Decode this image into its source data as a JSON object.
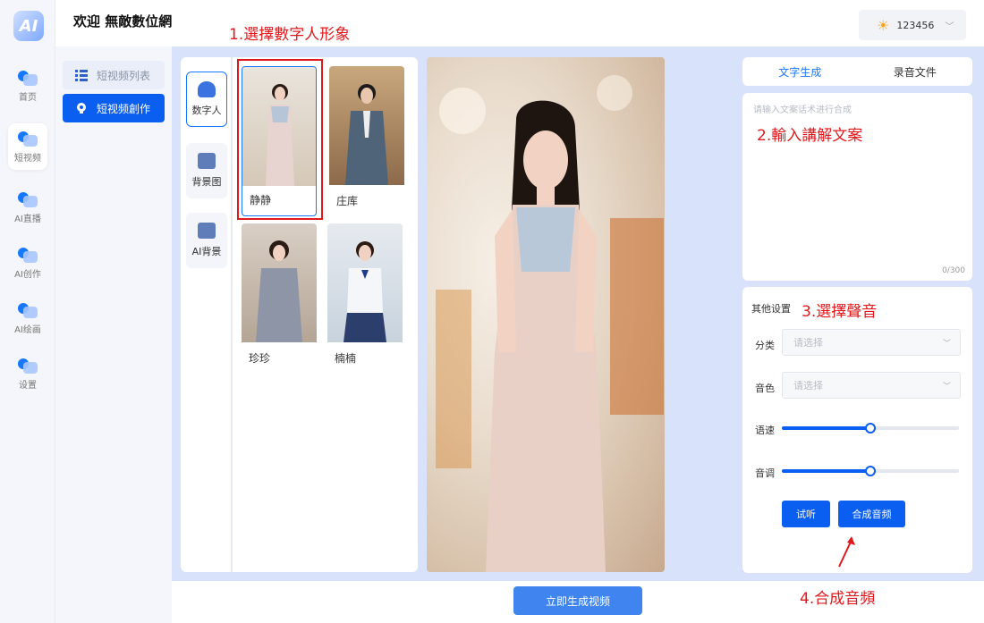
{
  "header": {
    "title": "欢迎 無敵數位網",
    "username": "123456",
    "logo_text": "AI"
  },
  "rail": [
    {
      "label": "首页",
      "icon": "home-icon"
    },
    {
      "label": "短视频",
      "icon": "short-video-icon",
      "active": true
    },
    {
      "label": "AI直播",
      "icon": "live-icon"
    },
    {
      "label": "AI创作",
      "icon": "create-icon"
    },
    {
      "label": "AI绘画",
      "icon": "paint-icon"
    },
    {
      "label": "设置",
      "icon": "gear-icon"
    }
  ],
  "submenu": {
    "list_label": "短视频列表",
    "create_label": "短视频創作"
  },
  "categories": [
    {
      "label": "数字人",
      "icon": "person-icon",
      "active": true
    },
    {
      "label": "背景图",
      "icon": "image-icon"
    },
    {
      "label": "AI背景",
      "icon": "ai-background-icon"
    }
  ],
  "avatars": [
    {
      "name": "静静",
      "selected": true
    },
    {
      "name": "庄库"
    },
    {
      "name": "珍珍"
    },
    {
      "name": "楠楠"
    }
  ],
  "tabs": {
    "text_gen": "文字生成",
    "recording": "录音文件"
  },
  "script_input": {
    "placeholder": "请输入文案话术进行合成",
    "counter": "0/300"
  },
  "settings": {
    "title": "其他设置",
    "category_label": "分类",
    "category_placeholder": "请选择",
    "voice_label": "音色",
    "voice_placeholder": "请选择",
    "speed_label": "语速",
    "speed_value": 0.5,
    "pitch_label": "音调",
    "pitch_value": 0.5,
    "preview_button": "试听",
    "synth_button": "合成音频"
  },
  "footer": {
    "generate_button": "立即生成视频"
  },
  "annotations": {
    "step1": "1.選擇數字人形象",
    "step2": "2.輸入講解文案",
    "step3": "3.選擇聲音",
    "step4": "4.合成音頻"
  },
  "colors": {
    "primary": "#0a5ef0",
    "annotation": "#e0191d",
    "main_bg": "#d8e2fb"
  }
}
